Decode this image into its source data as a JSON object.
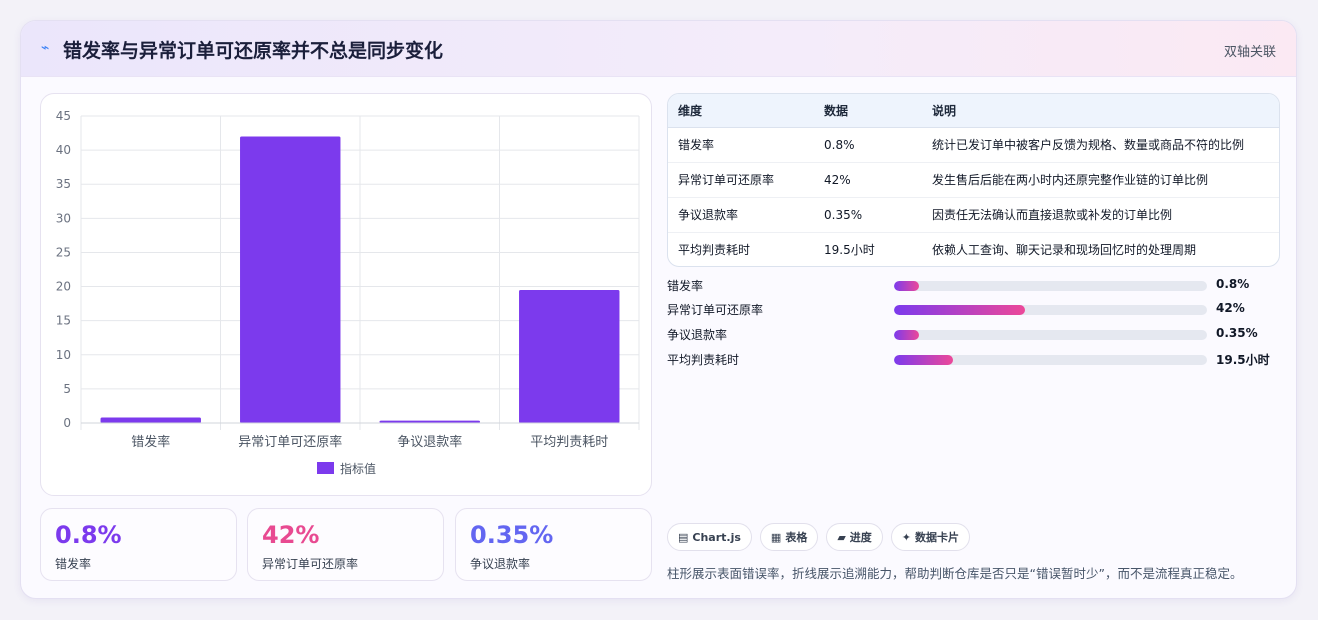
{
  "header": {
    "icon": "trend-icon",
    "title": "错发率与异常订单可还原率并不总是同步变化",
    "tag": "双轴关联"
  },
  "chart_data": {
    "type": "bar",
    "categories": [
      "错发率",
      "异常订单可还原率",
      "争议退款率",
      "平均判责耗时"
    ],
    "series": [
      {
        "name": "指标值",
        "values": [
          0.8,
          42,
          0.35,
          19.5
        ]
      }
    ],
    "ylim": [
      0,
      45
    ],
    "yticks": [
      0,
      5,
      10,
      15,
      20,
      25,
      30,
      35,
      40,
      45
    ],
    "grid": true,
    "legend": "bottom",
    "bar_color": "#7c3aed"
  },
  "stats": [
    {
      "value": "0.8%",
      "label": "错发率",
      "color": "#7c3aed"
    },
    {
      "value": "42%",
      "label": "异常订单可还原率",
      "color": "#e84a91"
    },
    {
      "value": "0.35%",
      "label": "争议退款率",
      "color": "#6366f1"
    }
  ],
  "table": {
    "headers": [
      "维度",
      "数据",
      "说明"
    ],
    "rows": [
      [
        "错发率",
        "0.8%",
        "统计已发订单中被客户反馈为规格、数量或商品不符的比例"
      ],
      [
        "异常订单可还原率",
        "42%",
        "发生售后后能在两小时内还原完整作业链的订单比例"
      ],
      [
        "争议退款率",
        "0.35%",
        "因责任无法确认而直接退款或补发的订单比例"
      ],
      [
        "平均判责耗时",
        "19.5小时",
        "依赖人工查询、聊天记录和现场回忆时的处理周期"
      ]
    ]
  },
  "progress": [
    {
      "label": "错发率",
      "value": "0.8%",
      "fraction": 0.08
    },
    {
      "label": "异常订单可还原率",
      "value": "42%",
      "fraction": 0.42
    },
    {
      "label": "争议退款率",
      "value": "0.35%",
      "fraction": 0.08
    },
    {
      "label": "平均判责耗时",
      "value": "19.5小时",
      "fraction": 0.19
    }
  ],
  "chips": [
    {
      "icon": "chart-icon",
      "glyph": "▤",
      "label": "Chart.js"
    },
    {
      "icon": "table-icon",
      "glyph": "▦",
      "label": "表格"
    },
    {
      "icon": "progress-icon",
      "glyph": "▰",
      "label": "进度"
    },
    {
      "icon": "sparkle-icon",
      "glyph": "✦",
      "label": "数据卡片"
    }
  ],
  "footnote": "柱形展示表面错误率，折线展示追溯能力，帮助判断仓库是否只是“错误暂时少”，而不是流程真正稳定。"
}
